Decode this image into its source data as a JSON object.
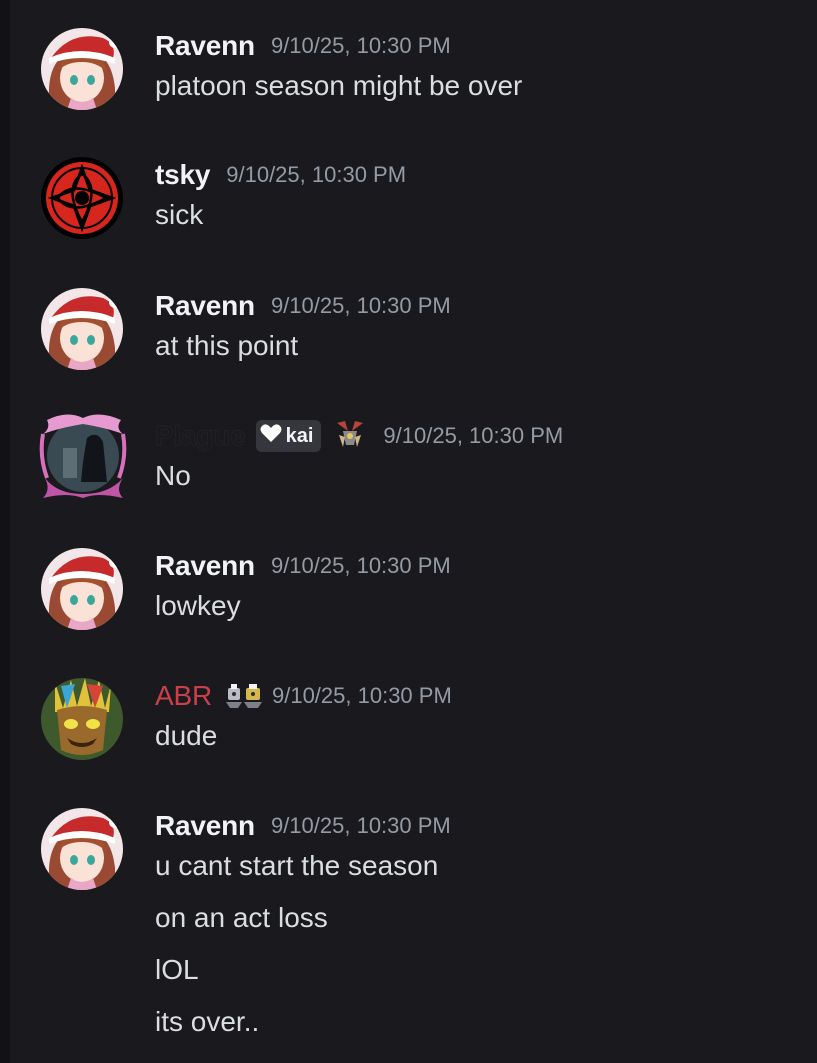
{
  "messages": [
    {
      "username": "Ravenn",
      "username_color": "#f2f3f5",
      "timestamp": "9/10/25, 10:30 PM",
      "avatar": "anime-girl-santa-hat-avatar",
      "lines": [
        "platoon season might be over"
      ]
    },
    {
      "username": "tsky",
      "username_color": "#f2f3f5",
      "timestamp": "9/10/25, 10:30 PM",
      "avatar": "red-sharingan-avatar",
      "lines": [
        "sick"
      ]
    },
    {
      "username": "Ravenn",
      "username_color": "#f2f3f5",
      "timestamp": "9/10/25, 10:30 PM",
      "avatar": "anime-girl-santa-hat-avatar",
      "lines": [
        "at this point"
      ]
    },
    {
      "username": "Plague",
      "username_color": "#1a1a1e",
      "tag": "kai",
      "tag_icon": "white-heart-icon",
      "badge_icon": "winged-emblem-icon",
      "timestamp": "9/10/25, 10:30 PM",
      "avatar": "dark-figure-pink-frame-avatar",
      "lines": [
        "No"
      ]
    },
    {
      "username": "Ravenn",
      "username_color": "#f2f3f5",
      "timestamp": "9/10/25, 10:30 PM",
      "avatar": "anime-girl-santa-hat-avatar",
      "lines": [
        "lowkey"
      ]
    },
    {
      "username": "ABR",
      "username_color": "#c8404a",
      "badge_icon": "robot-duo-icon",
      "timestamp": "9/10/25, 10:30 PM",
      "avatar": "tiki-mask-avatar",
      "lines": [
        "dude"
      ]
    },
    {
      "username": "Ravenn",
      "username_color": "#f2f3f5",
      "timestamp": "9/10/25, 10:30 PM",
      "avatar": "anime-girl-santa-hat-avatar",
      "lines": [
        "u cant start the season",
        "on an act loss",
        "lOL",
        "its over.."
      ]
    }
  ]
}
